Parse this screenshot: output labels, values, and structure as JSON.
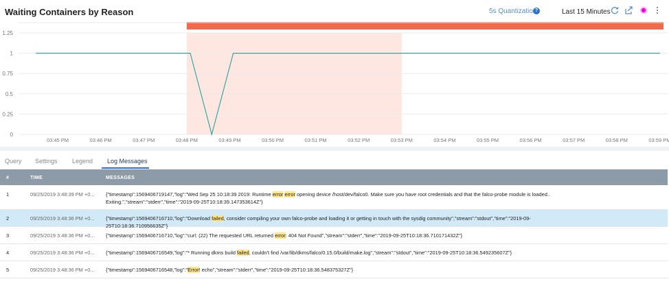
{
  "header": {
    "title": "Waiting Containers by Reason",
    "quantization": "5s Quantization",
    "time_range": "Last 15 Minutes"
  },
  "chart_data": {
    "type": "line",
    "y_ticks": [
      "1.25",
      "1",
      "0.75",
      "0.5",
      "0.25",
      "0"
    ],
    "ylim": [
      0,
      1.25
    ],
    "x_ticks": [
      "03:45 PM",
      "03:46 PM",
      "03:47 PM",
      "03:48 PM",
      "03:49 PM",
      "03:50 PM",
      "03:51 PM",
      "03:52 PM",
      "03:53 PM",
      "03:54 PM",
      "03:55 PM",
      "03:56 PM",
      "03:57 PM",
      "03:58 PM",
      "03:59 PM"
    ],
    "series": [
      {
        "color": "#3aa6a0",
        "points": [
          [
            "03:44:30",
            1
          ],
          [
            "03:48:05",
            1
          ],
          [
            "03:48:35",
            0
          ],
          [
            "03:49:05",
            1
          ],
          [
            "03:59:00",
            1
          ]
        ]
      }
    ],
    "highlight_range": [
      "03:48:00",
      "03:53:00"
    ],
    "event_bar": {
      "from": "03:48:00",
      "to": "03:59:00",
      "color": "#f26a4b"
    },
    "grid": true
  },
  "tabs": [
    {
      "label": "Query",
      "active": false
    },
    {
      "label": "Settings",
      "active": false
    },
    {
      "label": "Legend",
      "active": false
    },
    {
      "label": "Log Messages",
      "active": true
    }
  ],
  "table": {
    "columns": [
      "#",
      "TIME",
      "MESSAGES"
    ],
    "rows": [
      {
        "num": "1",
        "time": "09/25/2019 3:48:39 PM +0...",
        "parts": [
          {
            "t": "{\"timestamp\":1569406719147,\"log\":\"Wed Sep 25 10:18:39 2019: Runtime ",
            "h": false
          },
          {
            "t": "error",
            "h": true
          },
          {
            "t": " ",
            "h": false
          },
          {
            "t": "error",
            "h": true
          },
          {
            "t": " opening device /host/dev/falco0. Make sure you have root credentials and that the falco-probe module is loaded.. Exiting.\",\"stream\":\"stderr\",\"time\":\"2019-09-25T10:18:39.147353614Z\"}",
            "h": false
          }
        ]
      },
      {
        "num": "2",
        "time": "09/25/2019 3:48:36 PM +0...",
        "selected": true,
        "parts": [
          {
            "t": "{\"timestamp\":1569406716710,\"log\":\"Download ",
            "h": false
          },
          {
            "t": "failed",
            "h": true
          },
          {
            "t": ", consider compiling your own falco-probe and loading it or getting in touch with the sysdig community\",\"stream\":\"stdout\",\"time\":\"2019-09-25T10:18:36.710956635Z\"}",
            "h": false
          }
        ]
      },
      {
        "num": "3",
        "time": "09/25/2019 3:48:36 PM +0...",
        "parts": [
          {
            "t": "{\"timestamp\":1569406716710,\"log\":\"curl: (22) The requested URL returned ",
            "h": false
          },
          {
            "t": "error",
            "h": true
          },
          {
            "t": ": 404 Not Found\",\"stream\":\"stderr\",\"time\":\"2019-09-25T10:18:36.710171432Z\"}",
            "h": false
          }
        ]
      },
      {
        "num": "4",
        "time": "09/25/2019 3:48:36 PM +0...",
        "parts": [
          {
            "t": "{\"timestamp\":1569406716549,\"log\":\"* Running dkms build ",
            "h": false
          },
          {
            "t": "failed",
            "h": true
          },
          {
            "t": ", couldn't find /var/lib/dkms/falco/0.15.0/build/make.log\",\"stream\":\"stdout\",\"time\":\"2019-09-25T10:18:36.549235607Z\"}",
            "h": false
          }
        ]
      },
      {
        "num": "5",
        "time": "09/25/2019 3:48:36 PM +0...",
        "parts": [
          {
            "t": "{\"timestamp\":1569406716548,\"log\":\"",
            "h": false
          },
          {
            "t": "Error",
            "h": true
          },
          {
            "t": "! echo\",\"stream\":\"stderr\",\"time\":\"2019-09-25T10:18:36.548375327Z\"}",
            "h": false
          }
        ]
      }
    ]
  },
  "icons": [
    "help-icon",
    "refresh-icon",
    "export-icon",
    "palette-icon",
    "kebab-menu-icon"
  ]
}
